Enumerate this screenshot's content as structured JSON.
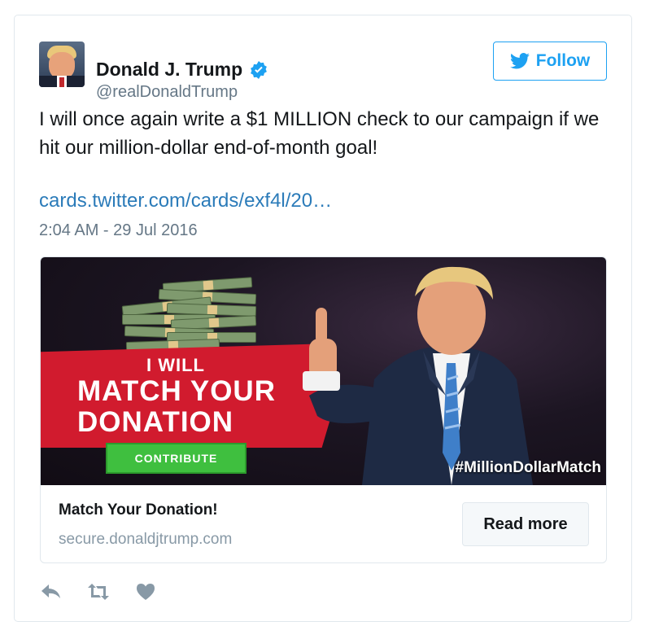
{
  "tweet": {
    "author_name": "Donald J. Trump",
    "handle": "@realDonaldTrump",
    "verified": true,
    "follow_label": "Follow",
    "text": "I will once again write a $1 MILLION check to our campaign if we hit our million-dollar end-of-month goal!",
    "link": "cards.twitter.com/cards/exf4l/20…",
    "timestamp": "2:04 AM - 29 Jul 2016"
  },
  "card": {
    "image": {
      "line1": "I WILL",
      "line2": "MATCH YOUR",
      "line3": "DONATION",
      "button": "CONTRIBUTE",
      "hashtag": "#MillionDollarMatch"
    },
    "title": "Match Your Donation!",
    "domain": "secure.donaldjtrump.com",
    "read_more_label": "Read more"
  },
  "actions": [
    {
      "icon": "reply-icon"
    },
    {
      "icon": "retweet-icon"
    },
    {
      "icon": "like-icon"
    }
  ],
  "colors": {
    "accent": "#1da1f2",
    "link": "#2b7bb9",
    "muted": "#657786",
    "banner_red": "#d11b2e",
    "contribute_green": "#3fbf3f"
  }
}
